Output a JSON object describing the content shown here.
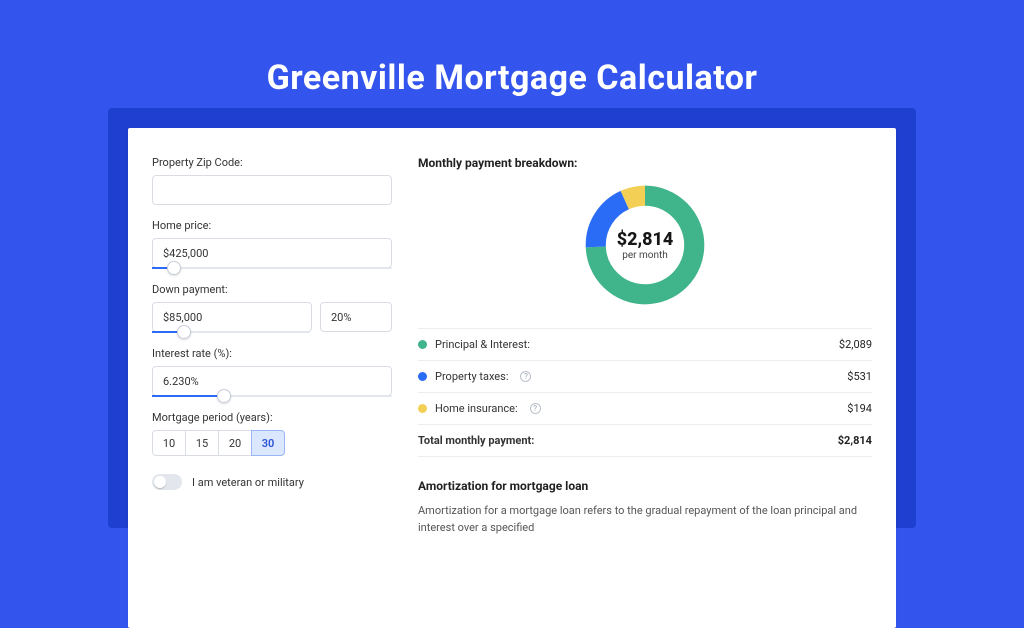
{
  "title": "Greenville Mortgage Calculator",
  "form": {
    "zip_label": "Property Zip Code:",
    "zip_value": "",
    "home_price_label": "Home price:",
    "home_price_value": "$425,000",
    "home_price_slider_pct": 9,
    "down_label": "Down payment:",
    "down_value": "$85,000",
    "down_pct_value": "20%",
    "down_slider_pct": 20,
    "rate_label": "Interest rate (%):",
    "rate_value": "6.230%",
    "rate_slider_pct": 30,
    "period_label": "Mortgage period (years):",
    "periods": [
      "10",
      "15",
      "20",
      "30"
    ],
    "period_active": "30",
    "veteran_label": "I am veteran or military",
    "veteran_on": false
  },
  "breakdown": {
    "title": "Monthly payment breakdown:",
    "center_value": "$2,814",
    "center_sub": "per month",
    "items": [
      {
        "name": "Principal & Interest:",
        "value": "$2,089",
        "color": "#40b48a",
        "amount": 2089,
        "has_info": false
      },
      {
        "name": "Property taxes:",
        "value": "$531",
        "color": "#2b6cf6",
        "amount": 531,
        "has_info": true
      },
      {
        "name": "Home insurance:",
        "value": "$194",
        "color": "#f3cf55",
        "amount": 194,
        "has_info": true
      }
    ],
    "total_label": "Total monthly payment:",
    "total_value": "$2,814"
  },
  "amort": {
    "title": "Amortization for mortgage loan",
    "text": "Amortization for a mortgage loan refers to the gradual repayment of the loan principal and interest over a specified"
  },
  "chart_data": {
    "type": "pie",
    "title": "Monthly payment breakdown",
    "series": [
      {
        "name": "Principal & Interest",
        "value": 2089,
        "color": "#40b48a"
      },
      {
        "name": "Property taxes",
        "value": 531,
        "color": "#2b6cf6"
      },
      {
        "name": "Home insurance",
        "value": 194,
        "color": "#f3cf55"
      }
    ],
    "total": 2814,
    "center_label": "$2,814 per month"
  }
}
